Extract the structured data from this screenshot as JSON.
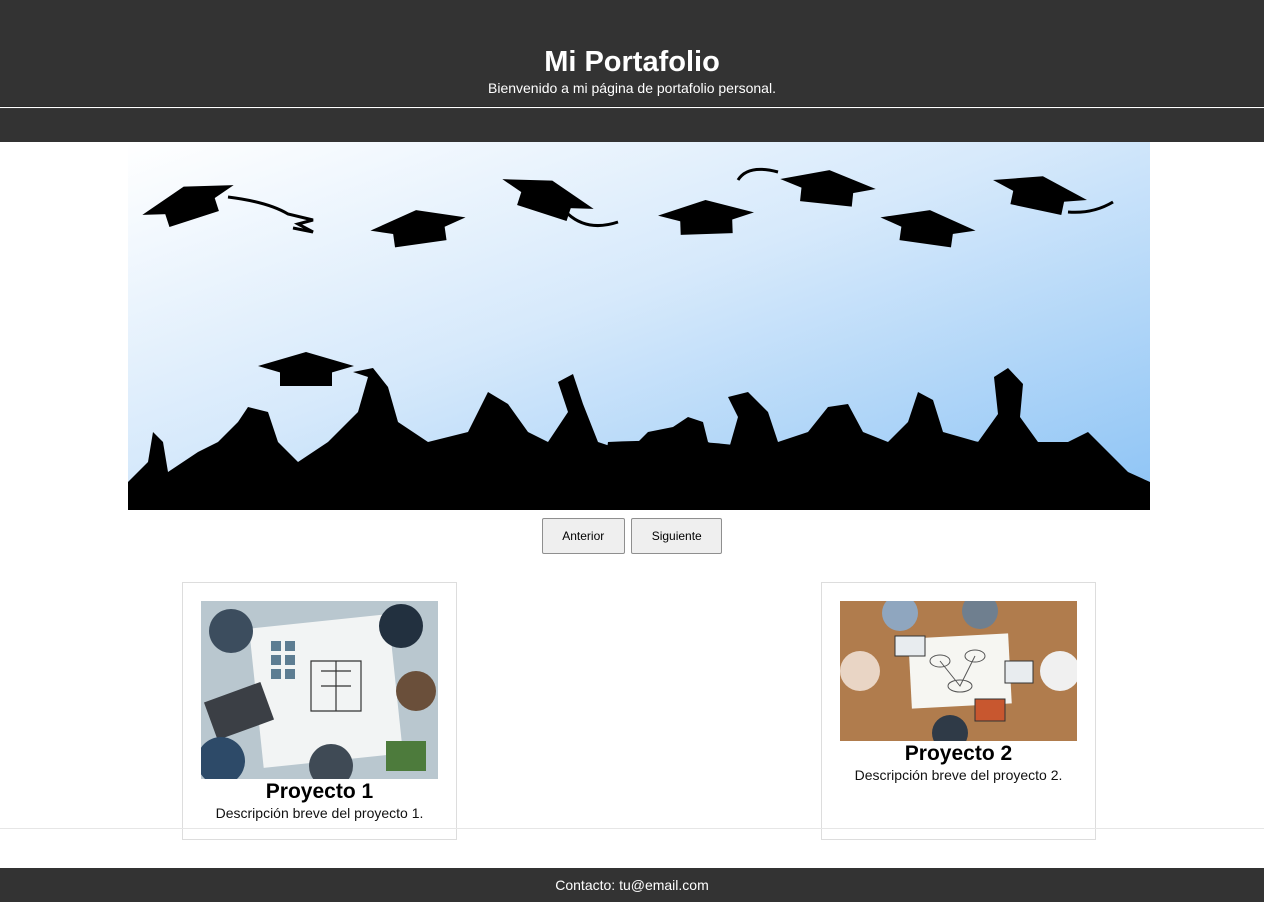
{
  "header": {
    "title": "Mi Portafolio",
    "subtitle": "Bienvenido a mi página de portafolio personal."
  },
  "slider": {
    "prev_label": "Anterior",
    "next_label": "Siguiente"
  },
  "projects": [
    {
      "title": "Proyecto 1",
      "description": "Descripción breve del proyecto 1."
    },
    {
      "title": "Proyecto 2",
      "description": "Descripción breve del proyecto 2."
    }
  ],
  "footer": {
    "contact": "Contacto: tu@email.com"
  },
  "colors": {
    "header_bg": "#333333",
    "sky_top": "#ffffff",
    "sky_bottom": "#8cc3f5"
  }
}
